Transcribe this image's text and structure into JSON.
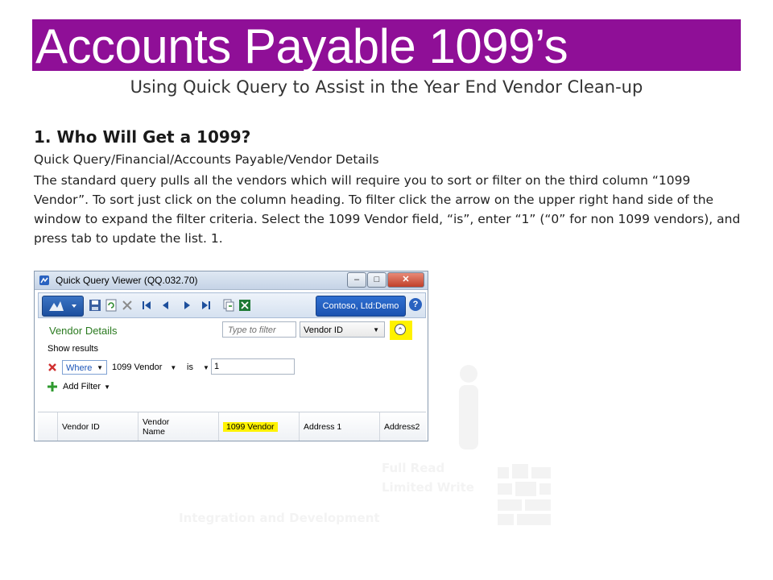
{
  "slide": {
    "title": "Accounts Payable 1099’s",
    "subtitle": "Using Quick Query to Assist in the Year End Vendor Clean-up",
    "heading": "1.  Who Will Get a 1099?",
    "path": "Quick Query/Financial/Accounts Payable/Vendor Details",
    "body": "The standard query pulls all the vendors which will require you to sort or filter on the third column “1099 Vendor”.  To sort just click on the column heading.  To filter click the arrow on the upper right hand side of the window to expand the filter criteria.  Select the 1099 Vendor field, “is”, enter “1” (“0” for non 1099 vendors), and press tab to update the list. 1.",
    "accent_color": "#8f0f97",
    "highlight_color": "#fff200"
  },
  "screenshot": {
    "window_title": "Quick Query Viewer (QQ.032.70)",
    "window_buttons": [
      "minimize-icon",
      "maximize-icon",
      "close-icon"
    ],
    "toolbar_icons": [
      "save-icon",
      "refresh-icon",
      "delete-icon",
      "first-icon",
      "previous-icon",
      "next-icon",
      "last-icon",
      "copy-icon",
      "excel-icon"
    ],
    "company": "Contoso, Ltd:Demo",
    "help": "?",
    "view_title": "Vendor Details",
    "filter_placeholder": "Type to filter",
    "filter_field": "Vendor ID",
    "show_results": "Show results",
    "where": "Where",
    "field": "1099 Vendor",
    "operator": "is",
    "value": "1",
    "add_filter": "Add Filter",
    "columns": [
      "Vendor ID",
      "Vendor Name",
      "1099 Vendor",
      "Address 1",
      "Address2"
    ]
  },
  "background": {
    "line1": "Full Read",
    "line2": "Limited Write",
    "line3": "Integration and Development"
  }
}
